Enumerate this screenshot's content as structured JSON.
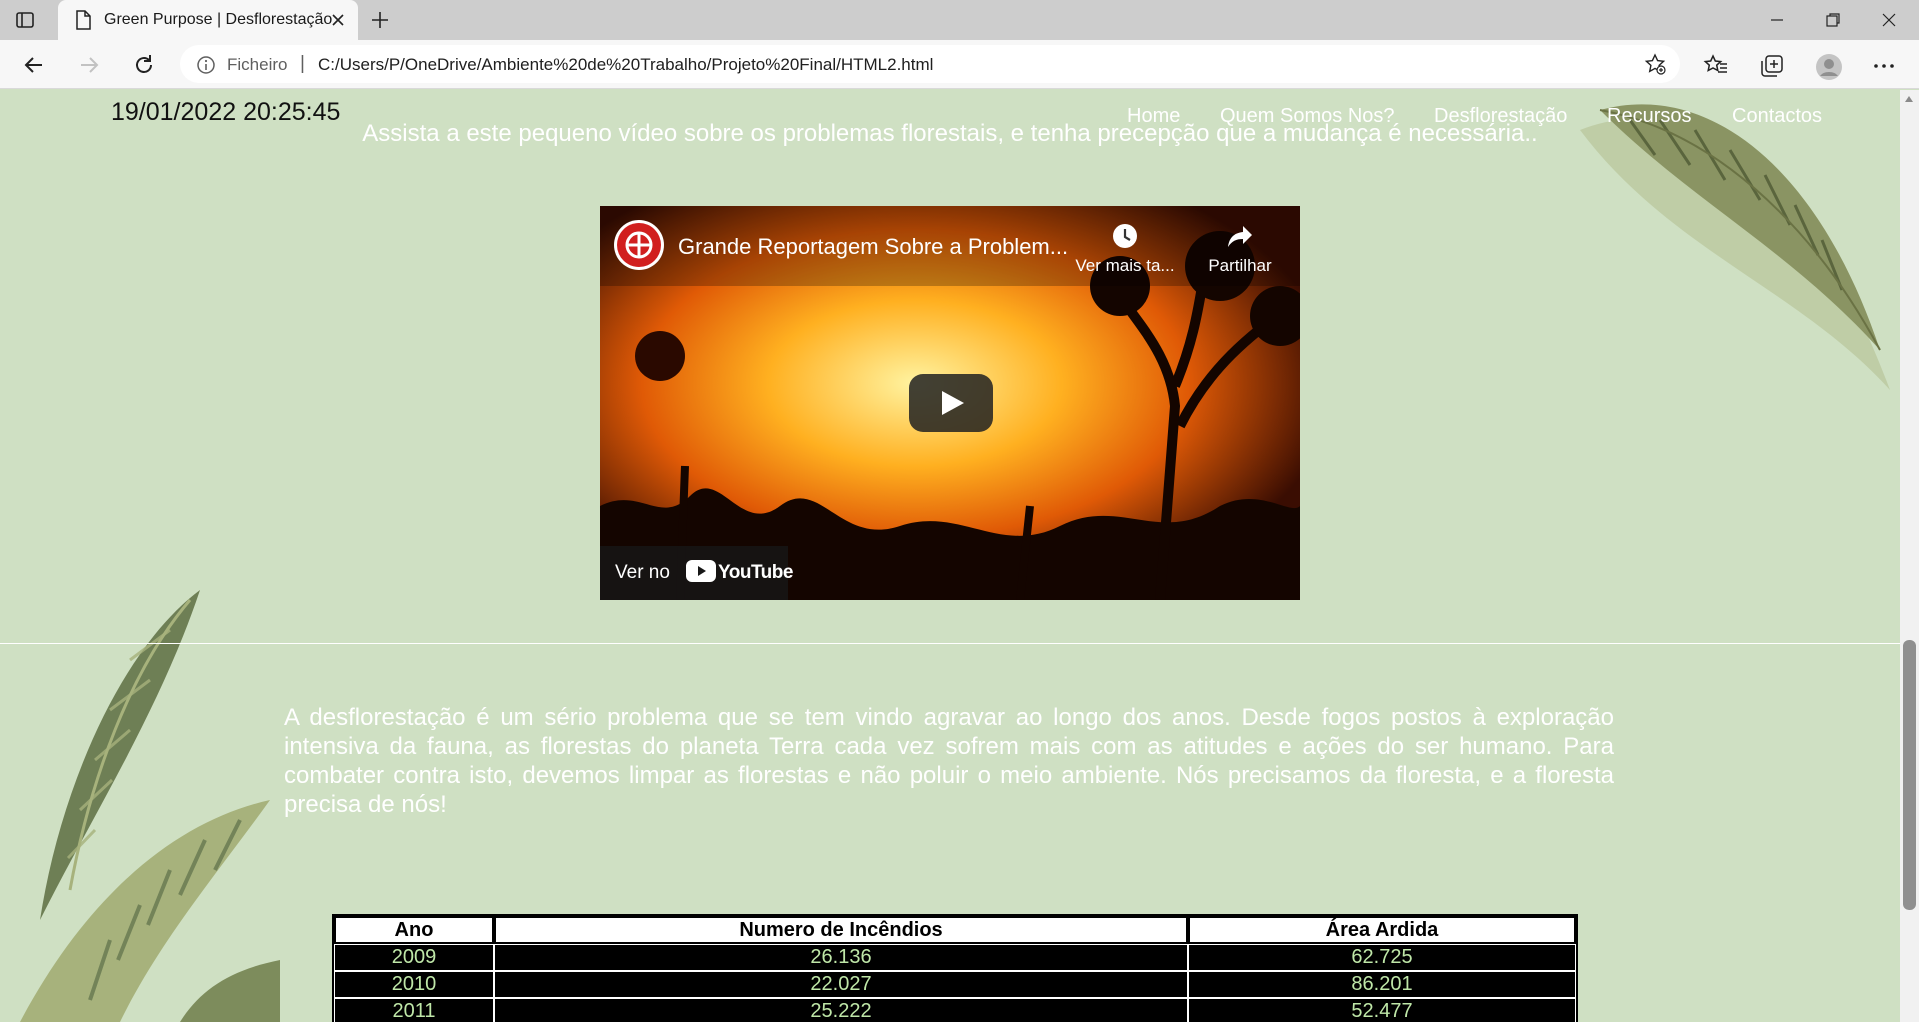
{
  "browser": {
    "tab_title": "Green Purpose | Desflorestação",
    "address_scheme": "Ficheiro",
    "address_separator": "|",
    "address_url": "C:/Users/P/OneDrive/Ambiente%20de%20Trabalho/Projeto%20Final/HTML2.html",
    "icons": [
      "tab-actions-icon",
      "document-icon",
      "close-icon",
      "plus-icon",
      "minimize-icon",
      "restore-icon",
      "close-window-icon",
      "back-icon",
      "forward-icon",
      "refresh-icon",
      "info-icon",
      "favorite-add-icon",
      "favorites-icon",
      "collections-icon",
      "profile-icon",
      "more-icon"
    ]
  },
  "header": {
    "clock": "19/01/2022 20:25:45",
    "nav": [
      "Home",
      "Quem Somos Nos?",
      "Desflorestação",
      "Recursos",
      "Contactos"
    ]
  },
  "intro_text": "Assista a este pequeno vídeo sobre os problemas florestais, e tenha precepção que a mudança é necessária..",
  "video": {
    "title": "Grande Reportagem Sobre a Problem...",
    "watch_later": "Ver mais ta...",
    "share": "Partilhar",
    "watch_on": "Ver no",
    "youtube": "YouTube"
  },
  "paragraph": "A desflorestação é um sério problema que se tem vindo agravar ao longo dos anos. Desde fogos postos à exploração intensiva da fauna, as florestas do planeta Terra cada vez sofrem mais com as atitudes e ações do ser humano. Para combater contra isto, devemos limpar as florestas e não poluir o meio ambiente. Nós precisamos da floresta, e a floresta precisa de nós!",
  "table": {
    "headers": [
      "Ano",
      "Numero de Incêndios",
      "Área Ardida"
    ],
    "rows": [
      [
        "2009",
        "26.136",
        "62.725"
      ],
      [
        "2010",
        "22.027",
        "86.201"
      ],
      [
        "2011",
        "25.222",
        "52.477"
      ]
    ]
  },
  "colors": {
    "page_background": "#cfe0c3",
    "table_text": "#bfe7a8",
    "leaf_dark": "#6e7f55",
    "leaf_light": "#a7b27c"
  }
}
